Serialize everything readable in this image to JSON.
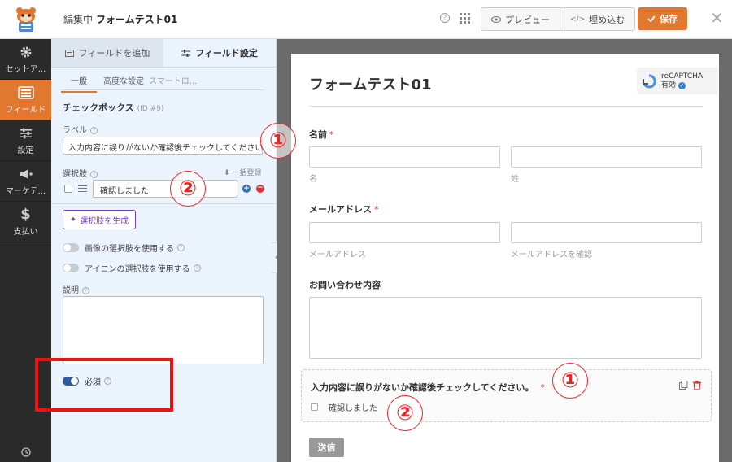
{
  "header": {
    "editing_label": "編集中",
    "form_name": "フォームテスト01",
    "preview_label": "プレビュー",
    "embed_label": "埋め込む",
    "save_label": "保存"
  },
  "nav": {
    "items": [
      {
        "label": "セットア...",
        "icon": "gear-icon"
      },
      {
        "label": "フィールド",
        "icon": "fields-icon"
      },
      {
        "label": "設定",
        "icon": "sliders-icon"
      },
      {
        "label": "マーケテ...",
        "icon": "megaphone-icon"
      },
      {
        "label": "支払い",
        "icon": "dollar-icon"
      }
    ],
    "active_index": 1
  },
  "panel": {
    "tab_add": "フィールドを追加",
    "tab_options": "フィールド設定",
    "subtab_general": "一般",
    "subtab_advanced": "高度な設定",
    "subtab_smart": "スマートロ...",
    "section_title": "チェックボックス",
    "section_id": "(ID #9)",
    "label_label": "ラベル",
    "label_value": "入力内容に誤りがないか確認後チェックしてください",
    "choices_label": "選択肢",
    "bulk_add": "一括登録",
    "choice_value": "確認しました",
    "generate_label": "選択肢を生成",
    "image_choices": "画像の選択肢を使用する",
    "icon_choices": "アイコンの選択肢を使用する",
    "description_label": "説明",
    "required_label": "必須"
  },
  "form": {
    "title": "フォームテスト01",
    "recaptcha_name": "reCAPTCHA",
    "recaptcha_status": "有効",
    "name_label": "名前",
    "first_sub": "名",
    "last_sub": "姓",
    "email_label": "メールアドレス",
    "email_sub": "メールアドレス",
    "email_confirm_sub": "メールアドレスを確認",
    "inquiry_label": "お問い合わせ内容",
    "checkbox_question": "入力内容に誤りがないか確認後チェックしてください。",
    "checkbox_option": "確認しました",
    "submit_label": "送信",
    "required_mark": "*"
  },
  "annotations": {
    "one": "①",
    "two": "②"
  },
  "colors": {
    "accent": "#e27730",
    "highlight": "#ee1111"
  }
}
